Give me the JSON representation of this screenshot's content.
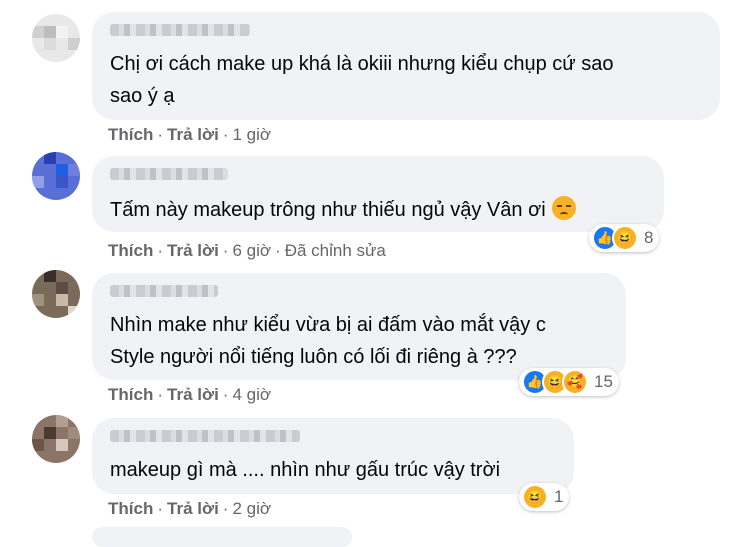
{
  "actions": {
    "like": "Thích",
    "reply": "Trả lời"
  },
  "comments": [
    {
      "text_lines": [
        "Chị ơi cách make up khá là okiii nhưng kiểu chụp cứ sao",
        "sao ý ạ"
      ],
      "time": "1 giờ"
    },
    {
      "text_lines": [
        "Tấm này makeup trông như thiếu ngủ vậy Vân ơi"
      ],
      "emoji_icon": "disappointed-face-icon",
      "time": "6 giờ",
      "edited": "Đã chỉnh sửa",
      "reactions": {
        "icons": [
          "like-icon",
          "haha-icon"
        ],
        "count": "8"
      }
    },
    {
      "text_lines": [
        "Nhìn make như kiểu vừa bị ai đấm vào mắt vậy c",
        "Style người nổi tiếng luôn có lối đi riêng à ???"
      ],
      "time": "4 giờ",
      "reactions": {
        "icons": [
          "like-icon",
          "haha-icon",
          "care-icon"
        ],
        "count": "15"
      }
    },
    {
      "text_lines": [
        "makeup gì mà .... nhìn như gấu trúc vậy trời"
      ],
      "time": "2 giờ",
      "reactions": {
        "icons": [
          "haha-icon"
        ],
        "count": "1"
      }
    }
  ],
  "colors": {
    "bubble": "#f0f2f5",
    "meta": "#65676b",
    "like": "#1877f2",
    "haha": "#f7b125"
  }
}
